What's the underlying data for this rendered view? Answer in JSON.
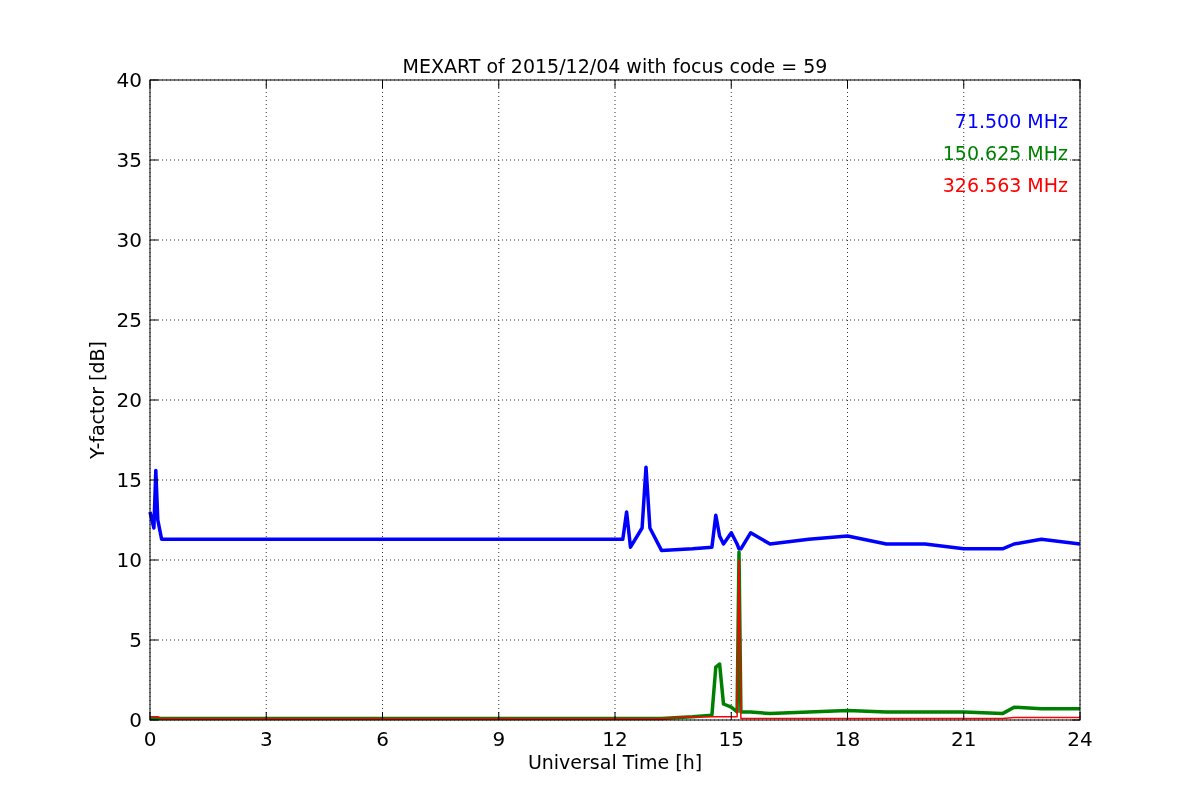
{
  "chart_data": {
    "type": "line",
    "title": "MEXART of 2015/12/04 with focus code = 59",
    "xlabel": "Universal Time [h]",
    "ylabel": "Y-factor [dB]",
    "xlim": [
      0,
      24
    ],
    "ylim": [
      0,
      40
    ],
    "xticks": [
      0,
      3,
      6,
      9,
      12,
      15,
      18,
      21,
      24
    ],
    "yticks": [
      0,
      5,
      10,
      15,
      20,
      25,
      30,
      35,
      40
    ],
    "grid": true,
    "x": [
      0,
      0.1,
      0.15,
      0.2,
      0.3,
      12.2,
      12.3,
      12.4,
      12.7,
      12.8,
      12.9,
      13.2,
      14,
      14.5,
      14.6,
      14.7,
      14.8,
      15,
      15.15,
      15.2,
      15.25,
      15.5,
      16,
      17,
      18,
      19,
      20,
      21,
      22,
      22.3,
      23,
      24
    ],
    "series": [
      {
        "name": "71.500 MHz",
        "color": "#0000ff",
        "values": [
          13,
          12,
          15.6,
          12.5,
          11.3,
          11.3,
          13,
          10.8,
          12,
          15.8,
          12,
          10.6,
          10.7,
          10.8,
          12.8,
          11.5,
          11,
          11.7,
          11,
          10.7,
          10.7,
          11.7,
          11,
          11.3,
          11.5,
          11,
          11,
          10.7,
          10.7,
          11,
          11.3,
          11
        ]
      },
      {
        "name": "150.625 MHz",
        "color": "#008000",
        "values": [
          0.1,
          0.1,
          0.1,
          0.1,
          0.1,
          0.1,
          0.1,
          0.1,
          0.1,
          0.1,
          0.1,
          0.1,
          0.2,
          0.3,
          3.3,
          3.5,
          1,
          0.8,
          0.5,
          10.5,
          0.5,
          0.5,
          0.4,
          0.5,
          0.6,
          0.5,
          0.5,
          0.5,
          0.4,
          0.8,
          0.7,
          0.7
        ]
      },
      {
        "name": "326.563 MHz",
        "color": "#ff0000",
        "values": [
          0.2,
          0.2,
          0.2,
          0.2,
          0.1,
          0.1,
          0.1,
          0.1,
          0.1,
          0.1,
          0.1,
          0.1,
          0.2,
          0.2,
          0.2,
          0.2,
          0.2,
          0.2,
          0.2,
          10,
          0.1,
          0.1,
          0.1,
          0.1,
          0.1,
          0.1,
          0.1,
          0.1,
          0.1,
          0.15,
          0.15,
          0.15
        ]
      }
    ]
  }
}
